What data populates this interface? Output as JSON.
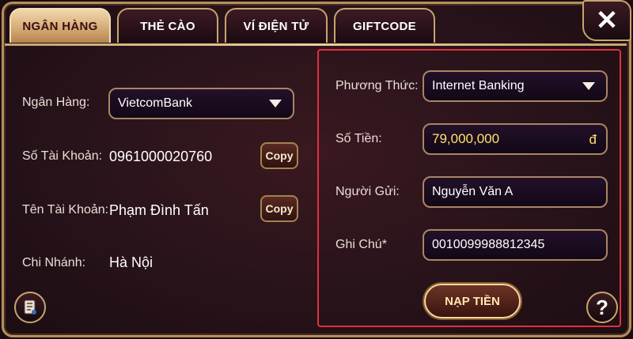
{
  "tabs": [
    {
      "label": "NGÂN HÀNG",
      "active": true
    },
    {
      "label": "THẺ CÀO",
      "active": false
    },
    {
      "label": "VÍ ĐIỆN TỬ",
      "active": false
    },
    {
      "label": "GIFTCODE",
      "active": false
    }
  ],
  "close_label": "✕",
  "bank_info": {
    "bank_label": "Ngân Hàng:",
    "bank_value": "VietcomBank",
    "account_number_label": "Số Tài Khoản:",
    "account_number_value": "0961000020760",
    "account_name_label": "Tên Tài Khoản:",
    "account_name_value": "Phạm Đình Tấn",
    "branch_label": "Chi Nhánh:",
    "branch_value": "Hà Nội",
    "copy_label": "Copy"
  },
  "deposit_form": {
    "method_label": "Phương Thức:",
    "method_value": "Internet Banking",
    "amount_label": "Số Tiền:",
    "amount_value": "79,000,000",
    "currency": "đ",
    "sender_label": "Người Gửi:",
    "sender_value": "Nguyễn Văn A",
    "note_label": "Ghi Chú*",
    "note_value": "0010099988812345",
    "submit_label": "NẠP TIỀN"
  },
  "help_label": "?",
  "icons": {
    "history": "history-icon",
    "help": "help-icon",
    "close": "close-icon",
    "dropdown": "chevron-down-icon"
  },
  "colors": {
    "accent_gold": "#c7a56c",
    "highlight_red": "#e0313a",
    "amount_yellow": "#ffe36a"
  }
}
